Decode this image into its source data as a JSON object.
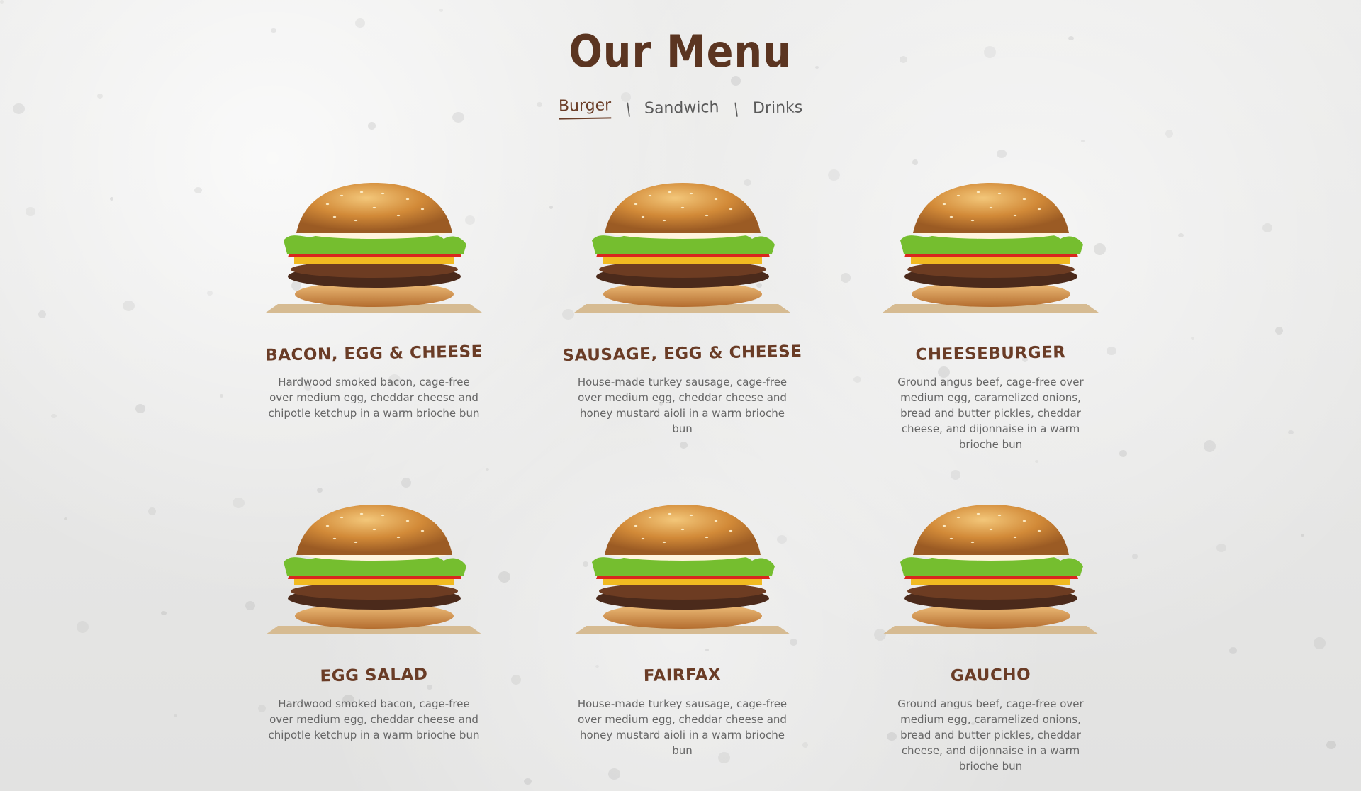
{
  "page": {
    "title": "Our Menu"
  },
  "menu": {
    "tabs": [
      {
        "label": "Burger",
        "active": true
      },
      {
        "label": "Sandwich",
        "active": false
      },
      {
        "label": "Drinks",
        "active": false
      }
    ],
    "separator": "|"
  },
  "items": [
    {
      "name": "BACON, EGG & CHEESE",
      "description": "Hardwood smoked bacon, cage-free over medium egg, cheddar cheese and chipotle ketchup in a warm brioche bun",
      "icon": "burger-image"
    },
    {
      "name": "SAUSAGE, EGG & CHEESE",
      "description": "House-made turkey sausage, cage-free over medium egg, cheddar cheese and honey mustard aioli in a warm brioche bun",
      "icon": "burger-image"
    },
    {
      "name": "CHEESEBURGER",
      "description": "Ground angus beef, cage-free over medium egg, caramelized onions, bread and butter pickles, cheddar cheese, and dijonnaise in a warm brioche bun",
      "icon": "burger-image"
    },
    {
      "name": "EGG SALAD",
      "description": "Hardwood smoked bacon, cage-free over medium egg, cheddar cheese and chipotle ketchup in a warm brioche bun",
      "icon": "burger-image"
    },
    {
      "name": "FAIRFAX",
      "description": "House-made turkey sausage, cage-free over medium egg, cheddar cheese and honey mustard aioli in a warm brioche bun",
      "icon": "burger-image"
    },
    {
      "name": "GAUCHO",
      "description": "Ground angus beef, cage-free over medium egg, caramelized onions, bread and butter pickles, cheddar cheese, and dijonnaise in a warm brioche bun",
      "icon": "burger-image"
    }
  ],
  "colors": {
    "title": "#5b3521",
    "accent": "#6a3c26",
    "text": "#666666",
    "background": "#e9e9e8"
  }
}
